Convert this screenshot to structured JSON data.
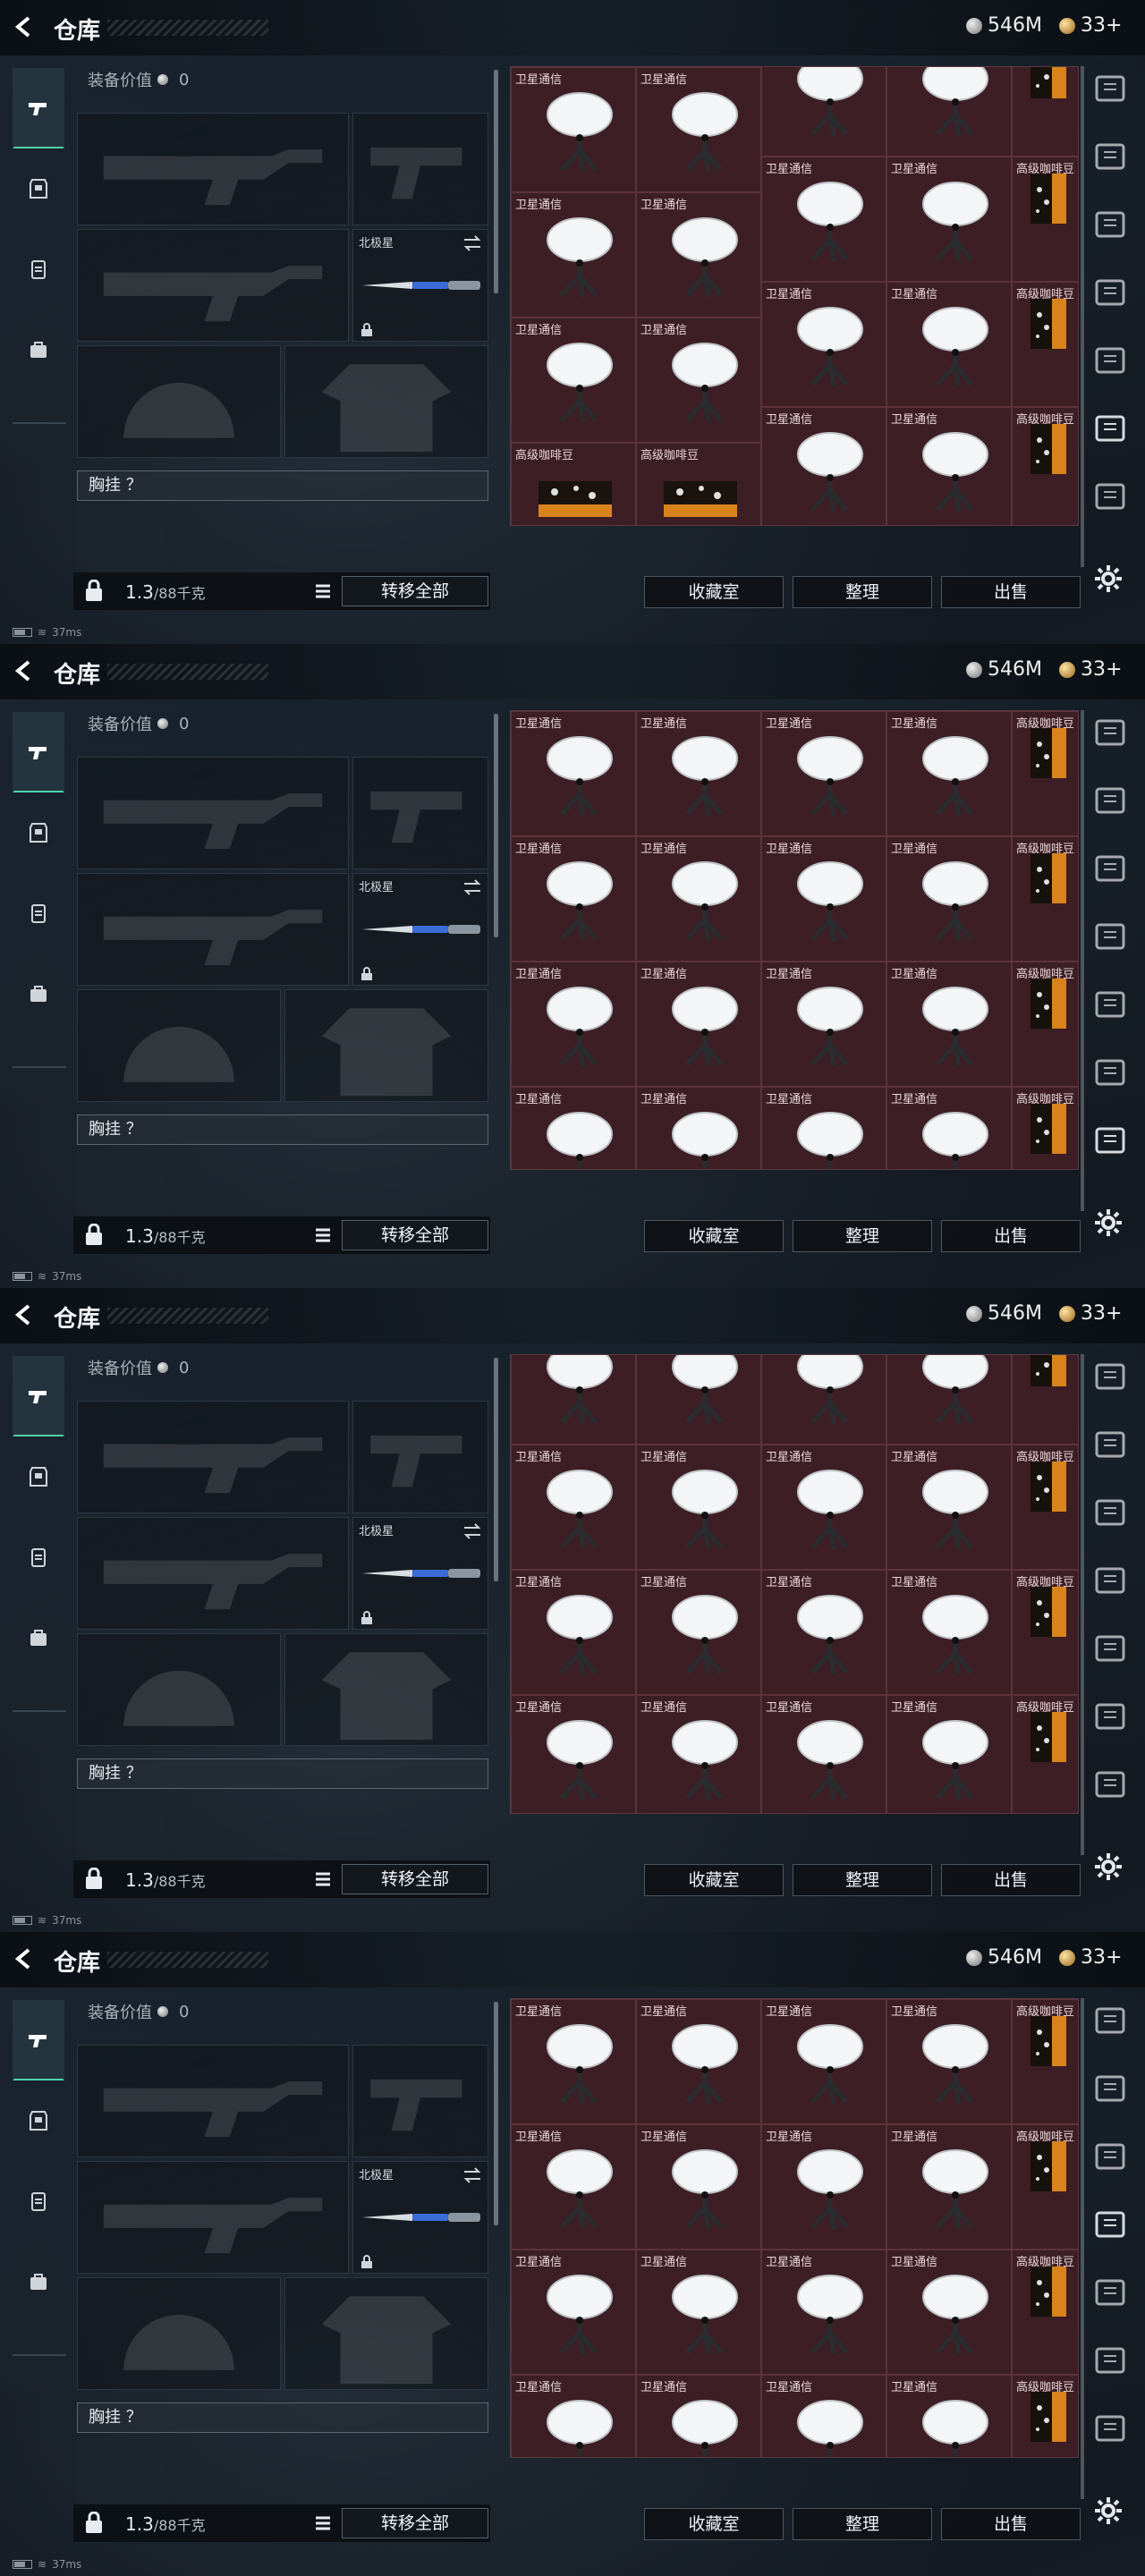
{
  "header": {
    "title": "仓库",
    "silver": "546M",
    "gold": "33+"
  },
  "left": {
    "equip_value_label": "装备价值",
    "equip_value": "0",
    "knife_slot_label": "北极星",
    "chest_rig": "胸挂 ？",
    "weight": "1.3",
    "weight_cap": "/88千克",
    "transfer_label": "转移全部"
  },
  "buttons": {
    "collection": "收藏室",
    "sort": "整理",
    "sell": "出售"
  },
  "items": {
    "satcom": "卫星通信",
    "coffee": "高级咖啡豆"
  },
  "status": {
    "ping": "37ms"
  },
  "frames": [
    {
      "top_label": false,
      "scroll": 0
    },
    {
      "top_label": true,
      "scroll": 1
    },
    {
      "top_label": false,
      "scroll": 2
    },
    {
      "top_label": true,
      "scroll": 3
    }
  ]
}
